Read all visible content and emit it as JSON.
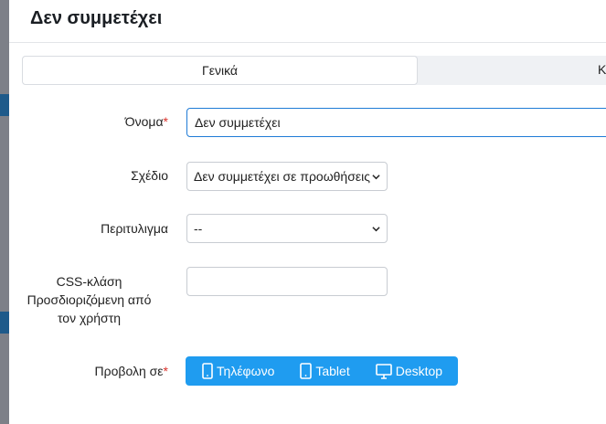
{
  "modal": {
    "title": "Δεν συμμετέχει"
  },
  "tabs": [
    {
      "label": "Γενικά"
    },
    {
      "label": "Κ"
    }
  ],
  "form": {
    "name": {
      "label": "Όνομα",
      "required_mark": "*",
      "value": "Δεν συμμετέχει"
    },
    "design": {
      "label": "Σχέδιο",
      "selected": "Δεν συμμετέχει σε προωθήσεις"
    },
    "wrapper": {
      "label": "Περιτυλιγμα",
      "selected": "--"
    },
    "css_class": {
      "label_line1": "CSS-κλάση",
      "label_line2": "Προσδιοριζόμενη από",
      "label_line3": "τον χρήστη",
      "value": ""
    },
    "display_on": {
      "label": "Προβολη σε",
      "required_mark": "*",
      "options": [
        {
          "label": "Τηλέφωνο",
          "icon": "phone-icon"
        },
        {
          "label": "Tablet",
          "icon": "tablet-icon"
        },
        {
          "label": "Desktop",
          "icon": "desktop-icon"
        }
      ]
    }
  },
  "colors": {
    "accent": "#1f9cf0",
    "focus_border": "#1f7bd6",
    "required": "#d9322b"
  }
}
